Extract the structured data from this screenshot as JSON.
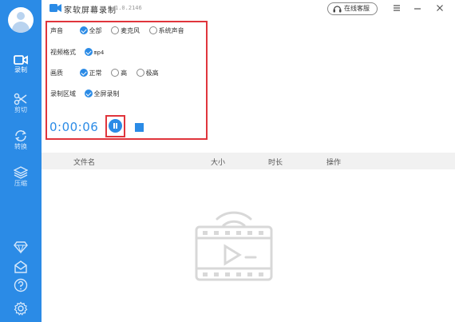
{
  "app": {
    "title": "家软屏幕录制",
    "version": "1.0.2146",
    "service_label": "在线客服"
  },
  "sidebar": {
    "items": [
      {
        "label": "录制",
        "icon": "video-camera-icon",
        "active": true
      },
      {
        "label": "剪切",
        "icon": "scissors-icon",
        "active": false
      },
      {
        "label": "转换",
        "icon": "convert-icon",
        "active": false
      },
      {
        "label": "压缩",
        "icon": "layers-icon",
        "active": false
      }
    ],
    "bottom_icons": [
      "diamond-icon",
      "mail-icon",
      "help-icon",
      "settings-icon"
    ]
  },
  "settings": {
    "audio": {
      "label": "声音",
      "options": [
        {
          "label": "全部",
          "selected": true
        },
        {
          "label": "麦克风",
          "selected": false
        },
        {
          "label": "系统声音",
          "selected": false
        }
      ]
    },
    "format": {
      "label": "视频格式",
      "options": [
        {
          "label": "mp4",
          "selected": true
        }
      ]
    },
    "quality": {
      "label": "画质",
      "options": [
        {
          "label": "正常",
          "selected": true
        },
        {
          "label": "高",
          "selected": false
        },
        {
          "label": "极高",
          "selected": false
        }
      ]
    },
    "area": {
      "label": "录制区域",
      "options": [
        {
          "label": "全屏录制",
          "selected": true
        }
      ]
    }
  },
  "controls": {
    "timer": "0:00:06"
  },
  "file_list": {
    "columns": [
      "文件名",
      "大小",
      "时长",
      "操作"
    ]
  },
  "colors": {
    "accent": "#2b8be6",
    "highlight": "#e0353c",
    "header_bg": "#f1f1f1"
  }
}
